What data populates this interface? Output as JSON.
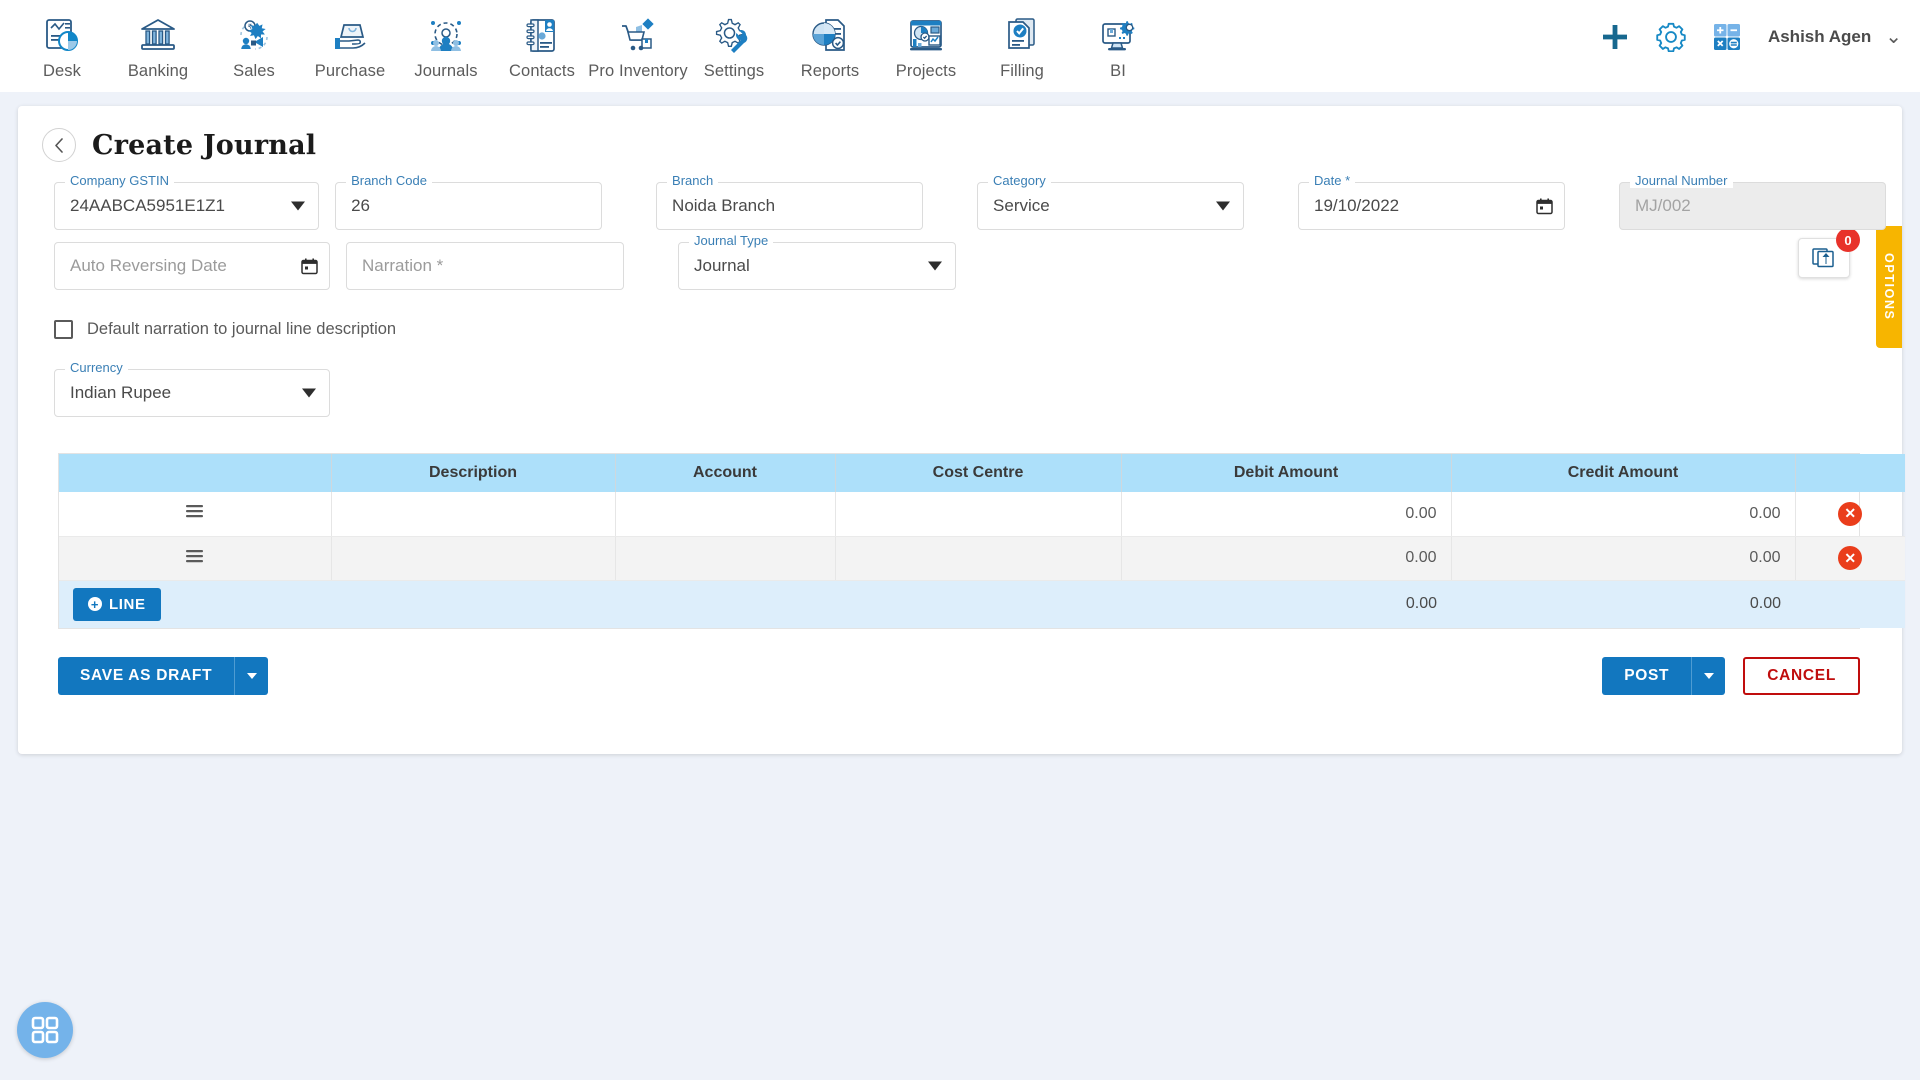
{
  "topnav": {
    "items": [
      {
        "label": "Desk",
        "icon": "desk-dashboard-icon"
      },
      {
        "label": "Banking",
        "icon": "bank-icon"
      },
      {
        "label": "Sales",
        "icon": "sales-megaphone-icon"
      },
      {
        "label": "Purchase",
        "icon": "purchase-hand-bag-icon"
      },
      {
        "label": "Journals",
        "icon": "journals-gear-people-icon"
      },
      {
        "label": "Contacts",
        "icon": "contacts-book-icon"
      },
      {
        "label": "Pro Inventory",
        "icon": "inventory-cart-icon"
      },
      {
        "label": "Settings",
        "icon": "settings-gear-wrench-icon"
      },
      {
        "label": "Reports",
        "icon": "reports-piechart-icon"
      },
      {
        "label": "Projects",
        "icon": "projects-dashboard-icon"
      },
      {
        "label": "Filling",
        "icon": "filling-documents-check-icon"
      },
      {
        "label": "BI",
        "icon": "bi-monitor-gear-icon"
      }
    ],
    "add_icon": "plus-icon",
    "settings_icon": "gear-icon",
    "calculator_icon": "calculator-icon",
    "user": "Ashish Agen",
    "user_chevron_icon": "chevron-down-icon"
  },
  "header": {
    "back_icon": "chevron-left-icon",
    "title": "Create Journal",
    "upload_icon": "upload-attachment-icon",
    "upload_badge": "0",
    "options_label": "OPTIONS"
  },
  "form": {
    "company_gstin": {
      "label": "Company GSTIN",
      "value": "24AABCA5951E1Z1"
    },
    "branch_code": {
      "label": "Branch Code",
      "value": "26"
    },
    "branch": {
      "label": "Branch",
      "value": "Noida Branch"
    },
    "category": {
      "label": "Category",
      "value": "Service"
    },
    "date": {
      "label": "Date *",
      "value": "19/10/2022"
    },
    "journal_number": {
      "label": "Journal Number",
      "value": "MJ/002"
    },
    "auto_reversing_date": {
      "placeholder": "Auto Reversing Date",
      "value": ""
    },
    "narration": {
      "placeholder": "Narration *",
      "value": ""
    },
    "journal_type": {
      "label": "Journal Type",
      "value": "Journal"
    },
    "default_narration_checkbox": {
      "label": "Default narration to journal line description",
      "checked": false
    },
    "currency": {
      "label": "Currency",
      "value": "Indian Rupee"
    }
  },
  "table": {
    "columns": [
      "",
      "Description",
      "Account",
      "Cost Centre",
      "Debit Amount",
      "Credit Amount",
      ""
    ],
    "rows": [
      {
        "handle_icon": "drag-handle-icon",
        "description": "",
        "account": "",
        "cost_centre": "",
        "debit": "0.00",
        "credit": "0.00",
        "delete_icon": "delete-circle-icon"
      },
      {
        "handle_icon": "drag-handle-icon",
        "description": "",
        "account": "",
        "cost_centre": "",
        "debit": "0.00",
        "credit": "0.00",
        "delete_icon": "delete-circle-icon"
      }
    ],
    "footer": {
      "add_line_label": "LINE",
      "add_line_icon": "plus-circle-icon",
      "total_debit": "0.00",
      "total_credit": "0.00"
    }
  },
  "actions": {
    "save_as_draft": "SAVE AS DRAFT",
    "save_dropdown_icon": "caret-down-icon",
    "post": "POST",
    "post_dropdown_icon": "caret-down-icon",
    "cancel": "CANCEL"
  },
  "fab": {
    "icon": "apps-grid-icon"
  },
  "colors": {
    "accent_blue": "#1277bf",
    "label_blue": "#3a7fb5",
    "table_header": "#ade0fa",
    "table_footer": "#ddeefb",
    "danger_red": "#ea3d1b",
    "cancel_red": "#c00d0d",
    "badge_red": "#e8322a",
    "options_yellow": "#f7b500",
    "page_bg": "#eef2f9"
  }
}
